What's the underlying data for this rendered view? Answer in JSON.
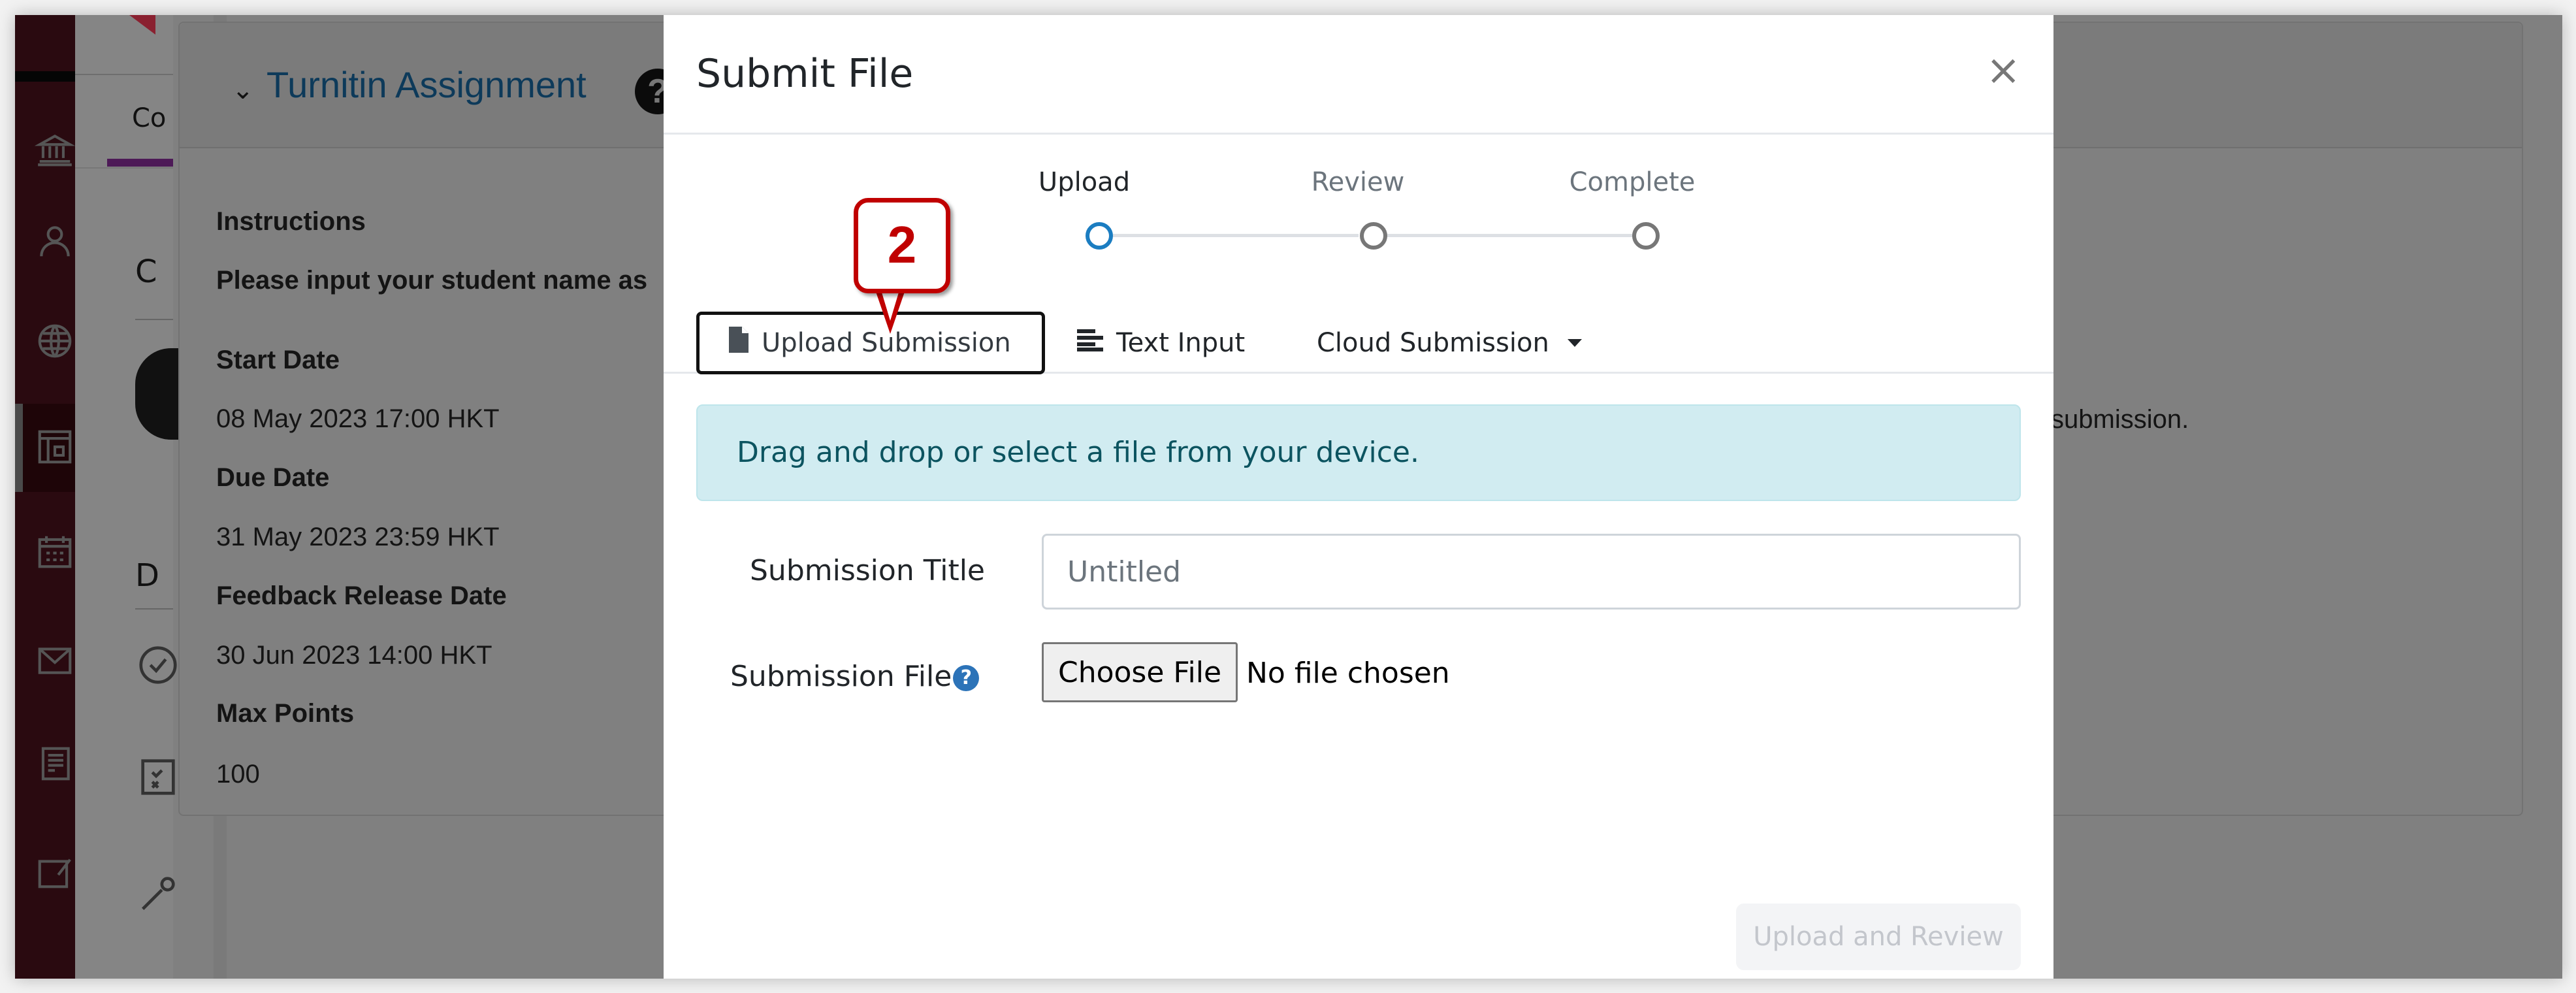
{
  "background": {
    "tab_partial": "Co",
    "section_c": "C",
    "section_d": "D",
    "card_title": "Turnitin Assignment",
    "help_glyph": "?",
    "chevron": "⌄",
    "fields": [
      {
        "label": "Instructions",
        "value": "Please input your student name as"
      },
      {
        "label": "Start Date",
        "value": "08 May 2023 17:00 HKT"
      },
      {
        "label": "Due Date",
        "value": "31 May 2023 23:59 HKT"
      },
      {
        "label": "Feedback Release Date",
        "value": "30 Jun 2023 14:00 HKT"
      },
      {
        "label": "Max Points",
        "value": "100"
      }
    ],
    "right_text_partial": "submission.",
    "sidebar_icons": [
      "institution-icon",
      "user-icon",
      "globe-icon",
      "course-icon",
      "calendar-icon",
      "messages-icon",
      "grades-icon",
      "edit-icon"
    ]
  },
  "modal": {
    "title": "Submit File",
    "close_glyph": "×",
    "steps": [
      {
        "label": "Upload",
        "state": "active"
      },
      {
        "label": "Review",
        "state": "inactive"
      },
      {
        "label": "Complete",
        "state": "inactive"
      }
    ],
    "tabs": {
      "upload": "Upload Submission",
      "text": "Text Input",
      "cloud": "Cloud Submission"
    },
    "alert": "Drag and drop or select a file from your device.",
    "title_label": "Submission Title",
    "title_placeholder": "Untitled",
    "title_value": "",
    "file_label": "Submission File",
    "help_glyph": "?",
    "choose_file": "Choose File",
    "no_file": "No file chosen",
    "submit_button": "Upload and Review"
  },
  "callout": {
    "number": "2"
  },
  "colors": {
    "accent_blue": "#1b7dc1",
    "alert_bg": "#d1ecf1",
    "alert_text": "#0c5460",
    "callout_red": "#c00000",
    "sidebar_bg": "#2a0a10"
  }
}
